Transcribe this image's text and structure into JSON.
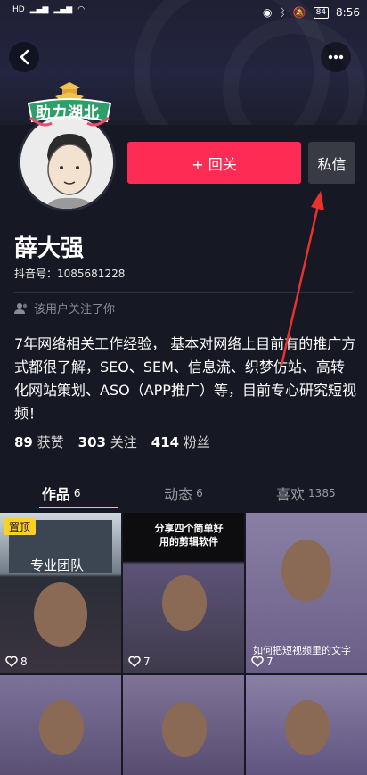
{
  "status_bar": {
    "left_text": "HD",
    "right_text": "8:56",
    "battery": "84"
  },
  "header": {
    "back_icon": "chevron-left-icon",
    "more_icon": "more-dots-icon"
  },
  "badge_text": "助力湖北",
  "actions": {
    "follow_back_label": "+ 回关",
    "message_label": "私信"
  },
  "profile": {
    "name": "薛大强",
    "douyin_id": "抖音号：1085681228",
    "followed_you": "该用户关注了你",
    "bio": "7年网络相关工作经验， 基本对网络上目前有的推广方式都很了解，SEO、SEM、信息流、织梦仿站、高转化网站策划、ASO（APP推广）等，目前专心研究短视频！"
  },
  "stats": [
    {
      "value": "89",
      "label": "获赞"
    },
    {
      "value": "303",
      "label": "关注"
    },
    {
      "value": "414",
      "label": "粉丝"
    }
  ],
  "tabs": [
    {
      "label": "作品",
      "count": "6"
    },
    {
      "label": "动态",
      "count": "6"
    },
    {
      "label": "喜欢",
      "count": "1385"
    }
  ],
  "videos": [
    {
      "pinned_label": "置顶",
      "caption": "专业团队",
      "likes": "8"
    },
    {
      "caption": "分享四个简单好用的剪辑软件",
      "likes": "7"
    },
    {
      "caption": "如何把短视频里的文字",
      "likes": "7"
    }
  ],
  "colors": {
    "accent": "#fe2c55",
    "background": "#161823",
    "tab_indicator": "#facf28"
  }
}
